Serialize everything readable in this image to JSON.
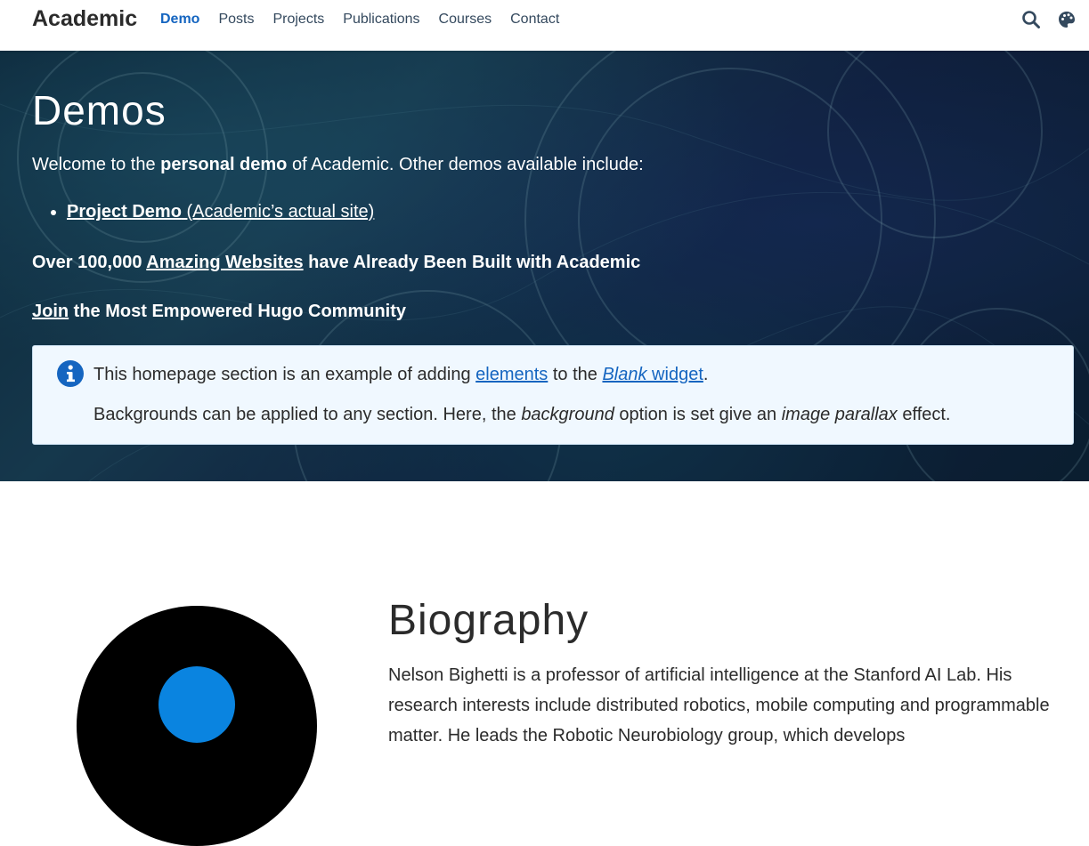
{
  "navbar": {
    "brand": "Academic",
    "links": [
      "Demo",
      "Posts",
      "Projects",
      "Publications",
      "Courses",
      "Contact"
    ],
    "icons": [
      "search-icon",
      "palette-icon"
    ]
  },
  "hero": {
    "title": "Demos",
    "intro": {
      "before": "Welcome to the ",
      "bold": "personal demo",
      "after": " of Academic. Other demos available include:"
    },
    "demo_link": {
      "label": "Project Demo",
      "suffix": " (Academic’s actual site)"
    },
    "line_websites": {
      "before": "Over 100,000 ",
      "link": "Amazing Websites",
      "after": " have Already Been Built with Academic"
    },
    "line_join": {
      "link": "Join",
      "after": " the Most Empowered Hugo Community"
    },
    "alert": {
      "line1_before": "This homepage section is an example of adding ",
      "line1_link": "elements",
      "line1_mid": " to the ",
      "line1_link2_italic": "Blank",
      "line1_link2_rest": " widget",
      "line1_end": ".",
      "line2_before": "Backgrounds can be applied to any section. Here, the ",
      "line2_em1": "background",
      "line2_mid": " option is set give an ",
      "line2_em2": "image parallax",
      "line2_end": " effect."
    }
  },
  "biography": {
    "title": "Biography",
    "text": "Nelson Bighetti is a professor of artificial intelligence at the Stanford AI Lab. His research interests include distributed robotics, mobile computing and programmable matter. He leads the Robotic Neurobiology group, which develops"
  },
  "colors": {
    "accent": "#1565c0",
    "avatar_dot": "#0a84e0",
    "alert_bg": "#f0f8ff"
  }
}
